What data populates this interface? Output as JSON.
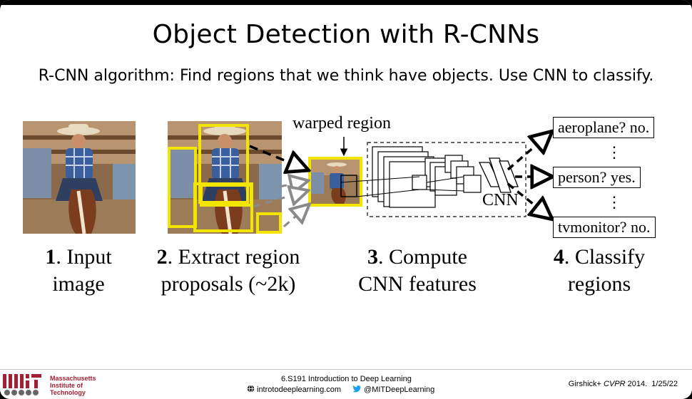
{
  "slide": {
    "title": "Object Detection with R-CNNs",
    "subtitle": "R-CNN algorithm: Find regions that we think have objects. Use CNN to classify."
  },
  "diagram": {
    "warped_label": "warped region",
    "cnn_label": "CNN",
    "outputs": [
      {
        "label": "aeroplane? no."
      },
      {
        "label": "person? yes."
      },
      {
        "label": "tvmonitor? no."
      }
    ],
    "dots": "⋮",
    "steps": [
      {
        "num": "1",
        "line1": ". Input",
        "line2": "image"
      },
      {
        "num": "2",
        "line1": ". Extract region",
        "line2": "proposals (~2k)"
      },
      {
        "num": "3",
        "line1": ". Compute",
        "line2": "CNN features"
      },
      {
        "num": "4",
        "line1": ". Classify",
        "line2": "regions"
      }
    ],
    "colors": {
      "proposal_box": "#f2e600",
      "arrow_dark": "#000000",
      "arrow_gray": "#8a8a8a"
    }
  },
  "footer": {
    "institution_line1": "Massachusetts",
    "institution_line2": "Institute of",
    "institution_line3": "Technology",
    "course": "6.S191 Introduction to Deep Learning",
    "website": "introtodeeplearning.com",
    "twitter": "@MITDeepLearning",
    "citation_author": "Girshick+",
    "citation_venue": "CVPR",
    "citation_rest": "2014.",
    "date": "1/25/22",
    "website_icon": "globe-icon",
    "twitter_icon": "twitter-bird-icon",
    "brand_color": "#a31f34"
  }
}
